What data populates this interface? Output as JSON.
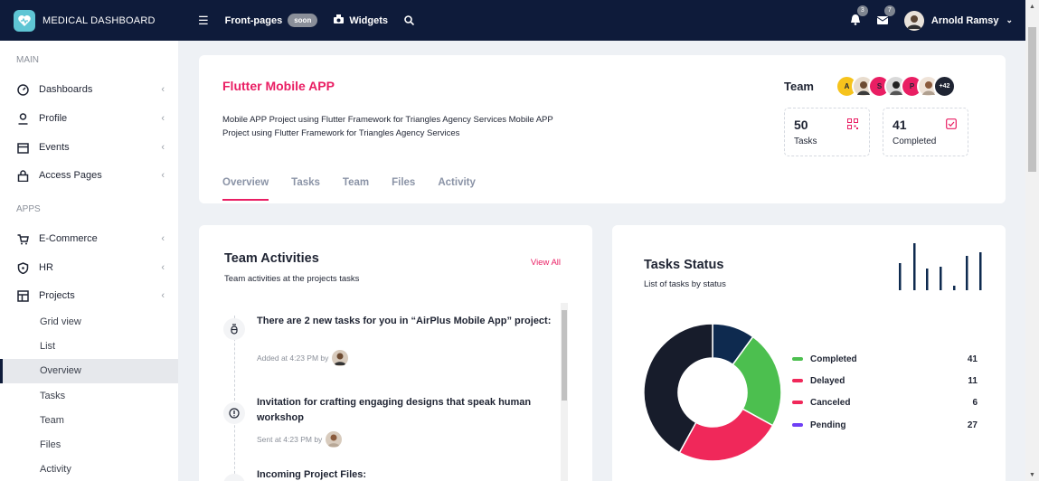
{
  "app": {
    "title": "MEDICAL DASHBOARD"
  },
  "topbar": {
    "menu_icon": "hamburger-icon",
    "frontpages_label": "Front-pages",
    "soon_badge": "soon",
    "widgets_label": "Widgets",
    "notifications_count": "3",
    "messages_count": "7",
    "user_name": "Arnold Ramsy"
  },
  "sidebar": {
    "main_section": "MAIN",
    "apps_section": "APPS",
    "main_items": [
      {
        "label": "Dashboards",
        "icon": "gauge-icon"
      },
      {
        "label": "Profile",
        "icon": "user-icon"
      },
      {
        "label": "Events",
        "icon": "calendar-icon"
      },
      {
        "label": "Access Pages",
        "icon": "lock-icon"
      }
    ],
    "app_items": [
      {
        "label": "E-Commerce",
        "icon": "cart-icon"
      },
      {
        "label": "HR",
        "icon": "shield-icon"
      },
      {
        "label": "Projects",
        "icon": "layout-icon"
      }
    ],
    "project_subitems": [
      "Grid view",
      "List",
      "Overview",
      "Tasks",
      "Team",
      "Files",
      "Activity"
    ],
    "active_subitem": "Overview"
  },
  "project": {
    "title": "Flutter Mobile APP",
    "description": "Mobile APP Project using Flutter Framework for Triangles Agency Services Mobile APP Project using Flutter Framework for Triangles Agency Services",
    "team_label": "Team",
    "team_members": [
      "A",
      "",
      "S",
      "",
      "P",
      "",
      "+42"
    ],
    "stats": [
      {
        "value": "50",
        "label": "Tasks",
        "icon": "qr-icon"
      },
      {
        "value": "41",
        "label": "Completed",
        "icon": "checkbox-icon"
      }
    ],
    "tabs": [
      "Overview",
      "Tasks",
      "Team",
      "Files",
      "Activity"
    ],
    "active_tab": "Overview"
  },
  "activities": {
    "title": "Team Activities",
    "subtitle": "Team activities at the projects tasks",
    "view_all": "View All",
    "items": [
      {
        "text": "There are 2 new tasks for you in “AirPlus Mobile App” project:",
        "meta": "Added at 4:23 PM by",
        "icon": "bug-icon"
      },
      {
        "text": "Invitation for crafting engaging designs that speak human workshop",
        "meta": "Sent at 4:23 PM by",
        "icon": "info-icon"
      },
      {
        "text": "Incoming Project Files:",
        "meta": "",
        "icon": "file-icon"
      }
    ]
  },
  "tasks_status": {
    "title": "Tasks Status",
    "subtitle": "List of tasks by status",
    "colors": {
      "completed": "#4cbf4f",
      "delayed": "#f0285a",
      "canceled": "#f0285a",
      "pending": "#6f3ff5",
      "dark": "#171c2b",
      "navy": "#0e2a4f"
    }
  },
  "chart_data": {
    "type": "pie",
    "title": "Tasks Status",
    "categories": [
      "Completed",
      "Delayed",
      "Canceled",
      "Pending"
    ],
    "values": [
      41,
      11,
      6,
      27
    ]
  }
}
